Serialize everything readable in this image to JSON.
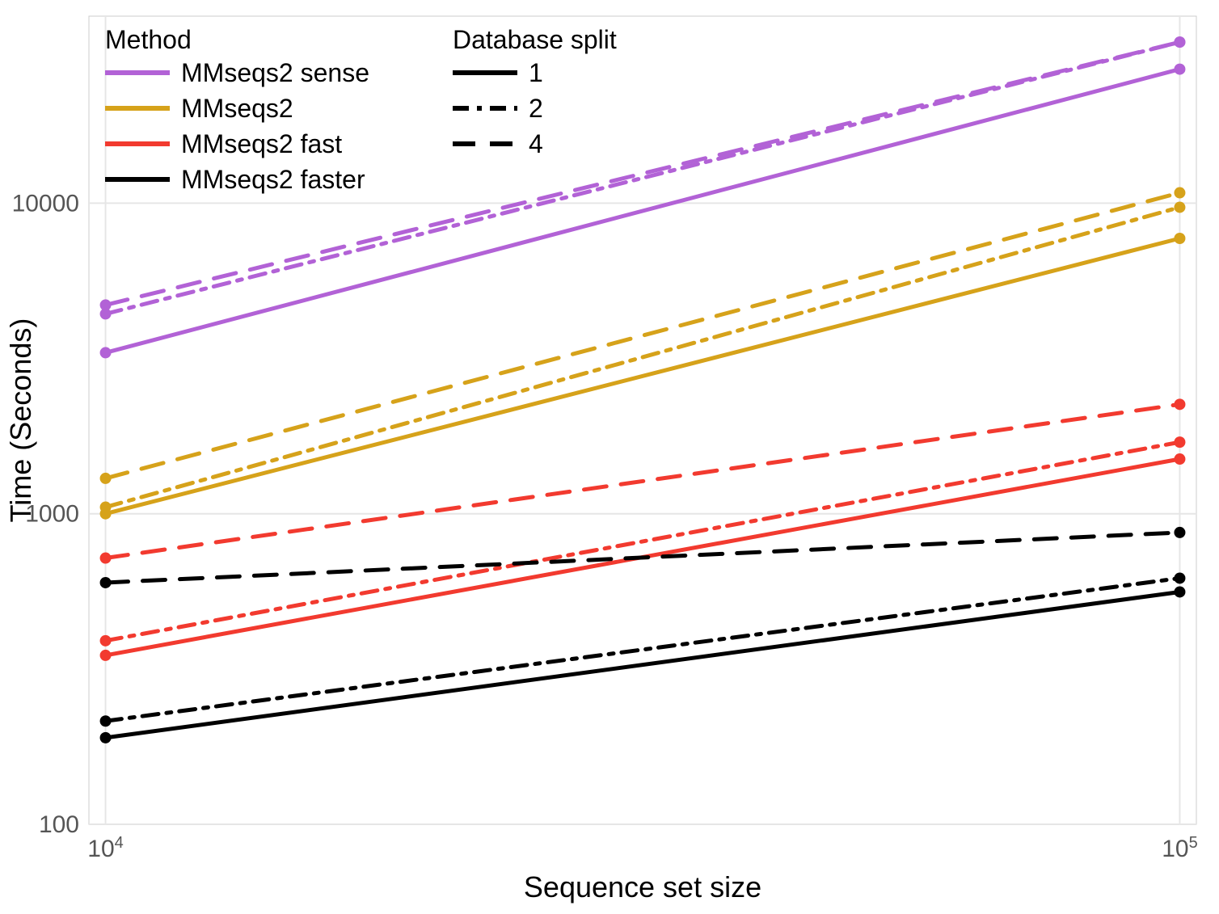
{
  "chart_data": {
    "type": "line",
    "xlabel": "Sequence set size",
    "ylabel": "Time (Seconds)",
    "xscale": "log10",
    "yscale": "log10",
    "xlim": [
      10000,
      100000
    ],
    "ylim": [
      100,
      40000
    ],
    "xticks": [
      10000,
      100000
    ],
    "xtick_labels": [
      "10^4",
      "10^5"
    ],
    "yticks": [
      100,
      1000,
      10000
    ],
    "ytick_labels": [
      "100",
      "1000",
      "10000"
    ],
    "legend_method_title": "Method",
    "legend_split_title": "Database split",
    "methods": [
      {
        "name": "MMseqs2 sense",
        "color": "#b262d6"
      },
      {
        "name": "MMseqs2",
        "color": "#d6a21a"
      },
      {
        "name": "MMseqs2 fast",
        "color": "#f23a2f"
      },
      {
        "name": "MMseqs2 faster",
        "color": "#000000"
      }
    ],
    "splits": [
      {
        "name": "1",
        "dash": "solid"
      },
      {
        "name": "2",
        "dash": "dash-dot"
      },
      {
        "name": "4",
        "dash": "long-dash"
      }
    ],
    "x": [
      10000,
      100000
    ],
    "series": [
      {
        "method": "MMseqs2 sense",
        "split": "1",
        "values": [
          3300,
          27000
        ]
      },
      {
        "method": "MMseqs2 sense",
        "split": "2",
        "values": [
          4400,
          33000
        ]
      },
      {
        "method": "MMseqs2 sense",
        "split": "4",
        "values": [
          4700,
          33000
        ]
      },
      {
        "method": "MMseqs2",
        "split": "1",
        "values": [
          1000,
          7700
        ]
      },
      {
        "method": "MMseqs2",
        "split": "2",
        "values": [
          1050,
          9700
        ]
      },
      {
        "method": "MMseqs2",
        "split": "4",
        "values": [
          1300,
          10800
        ]
      },
      {
        "method": "MMseqs2 fast",
        "split": "1",
        "values": [
          350,
          1500
        ]
      },
      {
        "method": "MMseqs2 fast",
        "split": "2",
        "values": [
          390,
          1700
        ]
      },
      {
        "method": "MMseqs2 fast",
        "split": "4",
        "values": [
          720,
          2250
        ]
      },
      {
        "method": "MMseqs2 faster",
        "split": "1",
        "values": [
          190,
          560
        ]
      },
      {
        "method": "MMseqs2 faster",
        "split": "2",
        "values": [
          215,
          620
        ]
      },
      {
        "method": "MMseqs2 faster",
        "split": "4",
        "values": [
          600,
          870
        ]
      }
    ]
  },
  "legend": {
    "method_title": "Method",
    "split_title": "Database split",
    "methods": [
      "MMseqs2 sense",
      "MMseqs2",
      "MMseqs2 fast",
      "MMseqs2 faster"
    ],
    "splits": [
      "1",
      "2",
      "4"
    ]
  },
  "axes": {
    "xlabel": "Sequence set size",
    "ylabel": "Time (Seconds)",
    "xtick0_base": "10",
    "xtick0_exp": "4",
    "xtick1_base": "10",
    "xtick1_exp": "5",
    "ytick0": "100",
    "ytick1": "1000",
    "ytick2": "10000"
  }
}
